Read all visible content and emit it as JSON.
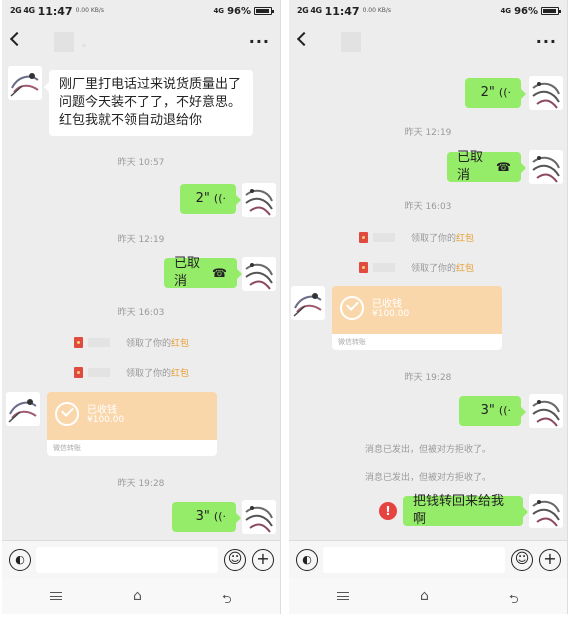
{
  "status": {
    "left_signal": "2G 4G",
    "time": "11:47",
    "speed": "0.00\nKB/s",
    "right_signal": "4G",
    "battery": "96%"
  },
  "left": {
    "incoming_message": "刚厂里打电话过来说货质量出了问题今天装不了了，不好意思。红包我就不领自动退给你",
    "ts1": "昨天 10:57",
    "voice1": "2\"",
    "ts2": "昨天 12:19",
    "cancelled": "已取消",
    "ts3": "昨天 16:03",
    "sys_pre": "领取了你的",
    "sys_hl": "红包",
    "transfer_title": "已收钱",
    "transfer_amount": "¥100.00",
    "transfer_foot": "微信转账",
    "ts4": "昨天 19:28",
    "voice2": "3\""
  },
  "right": {
    "voice1": "2\"",
    "ts1": "昨天 12:19",
    "cancelled": "已取消",
    "ts2": "昨天 16:03",
    "sys_pre": "领取了你的",
    "sys_hl": "红包",
    "transfer_title": "已收钱",
    "transfer_amount": "¥100.00",
    "transfer_foot": "微信转账",
    "ts3": "昨天 19:28",
    "voice2": "3\"",
    "rejected": "消息已发出，但被对方拒收了。",
    "outgoing_message": "把钱转回来给我啊"
  },
  "icons": {
    "voice": "((·",
    "hangup": "☎",
    "warning": "!",
    "voice_input": "◐",
    "emoji": "☺",
    "plus": "+",
    "home": "⌂",
    "back": "⮌",
    "more": "···"
  },
  "colors": {
    "chat_bg": "#ededed",
    "outgoing_bubble": "#95ec69",
    "transfer_card": "#fad7ab",
    "red_packet_highlight": "#e69d2e",
    "warning_red": "#e64340"
  }
}
